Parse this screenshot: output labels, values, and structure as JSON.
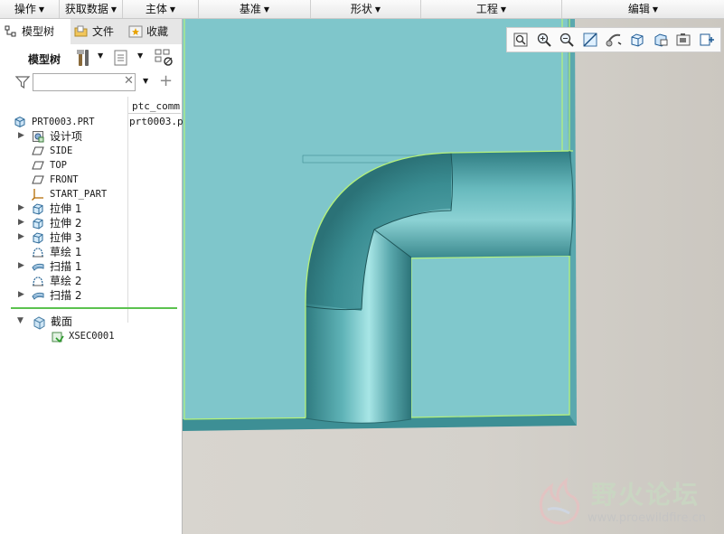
{
  "menubar": {
    "items": [
      "操作",
      "获取数据",
      "主体",
      "基准",
      "形状",
      "工程",
      "编辑"
    ]
  },
  "left_panel": {
    "tabs": [
      {
        "label": "模型树",
        "icon": "model-tree-icon",
        "active": true
      },
      {
        "label": "文件",
        "icon": "folder-icon",
        "active": false
      },
      {
        "label": "收藏",
        "icon": "favorites-icon",
        "active": false
      }
    ],
    "tree_toolbar_label": "模型树",
    "filter_value": "",
    "columns": {
      "col2_header": "ptc_comm",
      "col2_value": "prt0003.p"
    },
    "tree": [
      {
        "label": "PRT0003.PRT",
        "icon": "part-icon",
        "expandable": false,
        "indent": 0
      },
      {
        "label": "设计项",
        "icon": "design-items-icon",
        "expandable": true,
        "indent": 1
      },
      {
        "label": "SIDE",
        "icon": "datum-plane-icon",
        "expandable": false,
        "indent": 1
      },
      {
        "label": "TOP",
        "icon": "datum-plane-icon",
        "expandable": false,
        "indent": 1
      },
      {
        "label": "FRONT",
        "icon": "datum-plane-icon",
        "expandable": false,
        "indent": 1
      },
      {
        "label": "START_PART",
        "icon": "coordinate-system-icon",
        "expandable": false,
        "indent": 1
      },
      {
        "label": "拉伸 1",
        "icon": "extrude-icon",
        "expandable": true,
        "indent": 1
      },
      {
        "label": "拉伸 2",
        "icon": "extrude-icon",
        "expandable": true,
        "indent": 1
      },
      {
        "label": "拉伸 3",
        "icon": "extrude-icon",
        "expandable": true,
        "indent": 1
      },
      {
        "label": "草绘 1",
        "icon": "sketch-icon",
        "expandable": false,
        "indent": 1
      },
      {
        "label": "扫描 1",
        "icon": "sweep-icon",
        "expandable": true,
        "indent": 1
      },
      {
        "label": "草绘 2",
        "icon": "sketch-icon",
        "expandable": false,
        "indent": 1
      },
      {
        "label": "扫描 2",
        "icon": "sweep-icon",
        "expandable": true,
        "indent": 1
      }
    ],
    "sections": {
      "label": "截面",
      "child": "XSEC0001"
    }
  },
  "view_toolbar": [
    "refit-icon",
    "zoom-in-icon",
    "zoom-out-icon",
    "reorient-icon",
    "saved-views-icon",
    "display-style-icon",
    "view-manager-icon",
    "perspective-icon",
    "annotation-display-icon"
  ],
  "watermark": {
    "title": "野火论坛",
    "url": "www.proewildfire.cn"
  },
  "colors": {
    "model_teal": "#7ec8cc",
    "pipe_dark": "#3c8b90",
    "edge_green": "#b6f27a",
    "tree_green_line": "#5bc24f"
  }
}
